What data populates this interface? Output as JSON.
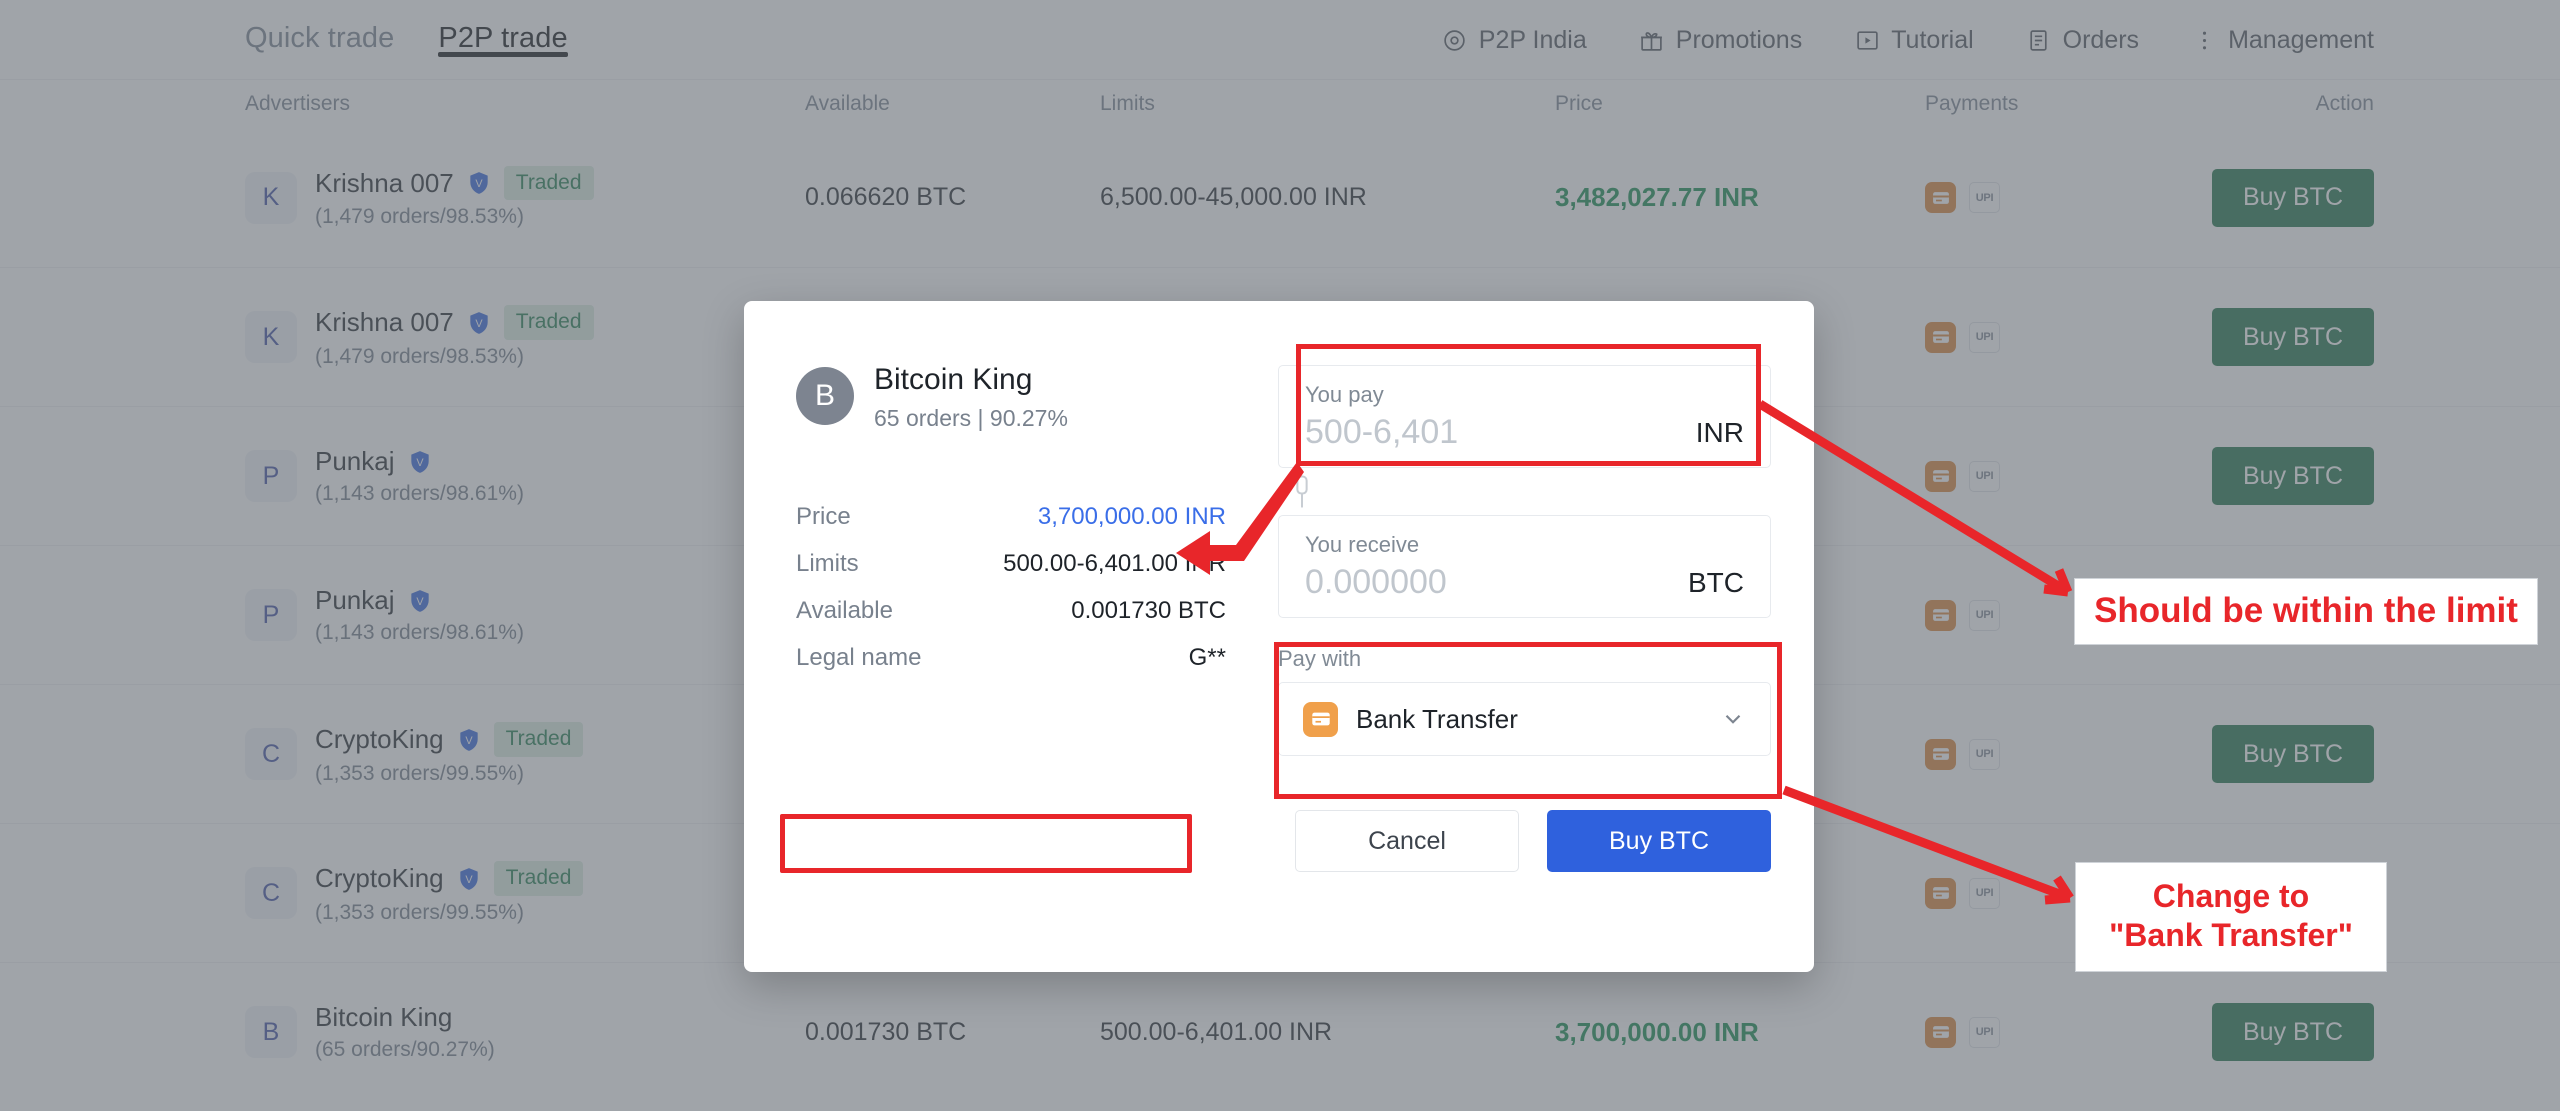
{
  "nav": {
    "tabs": [
      {
        "label": "Quick trade",
        "active": false
      },
      {
        "label": "P2P trade",
        "active": true
      }
    ],
    "links": [
      {
        "label": "P2P India",
        "icon": "globe-icon"
      },
      {
        "label": "Promotions",
        "icon": "gift-icon"
      },
      {
        "label": "Tutorial",
        "icon": "play-icon"
      },
      {
        "label": "Orders",
        "icon": "document-icon"
      },
      {
        "label": "Management",
        "icon": "kebab-menu-icon"
      }
    ]
  },
  "table": {
    "headers": {
      "advertisers": "Advertisers",
      "available": "Available",
      "limits": "Limits",
      "price": "Price",
      "payments": "Payments",
      "action": "Action"
    },
    "action_label": "Buy BTC",
    "traded_tag": "Traded",
    "payment_upi_label": "UPI",
    "rows": [
      {
        "initial": "K",
        "name": "Krishna 007",
        "verified": true,
        "traded": true,
        "stats": "(1,479 orders/98.53%)",
        "available": "0.066620 BTC",
        "limits": "6,500.00-45,000.00 INR",
        "price": "3,482,027.77 INR"
      },
      {
        "initial": "K",
        "name": "Krishna 007",
        "verified": true,
        "traded": true,
        "stats": "(1,479 orders/98.53%)",
        "available": "",
        "limits": "",
        "price": ""
      },
      {
        "initial": "P",
        "name": "Punkaj",
        "verified": true,
        "traded": false,
        "stats": "(1,143 orders/98.61%)",
        "available": "",
        "limits": "",
        "price": ""
      },
      {
        "initial": "P",
        "name": "Punkaj",
        "verified": true,
        "traded": false,
        "stats": "(1,143 orders/98.61%)",
        "available": "",
        "limits": "",
        "price": ""
      },
      {
        "initial": "C",
        "name": "CryptoKing",
        "verified": true,
        "traded": true,
        "stats": "(1,353 orders/99.55%)",
        "available": "",
        "limits": "",
        "price": ""
      },
      {
        "initial": "C",
        "name": "CryptoKing",
        "verified": true,
        "traded": true,
        "stats": "(1,353 orders/99.55%)",
        "available": "",
        "limits": "",
        "price": ""
      },
      {
        "initial": "B",
        "name": "Bitcoin King",
        "verified": false,
        "traded": false,
        "stats": "(65 orders/90.27%)",
        "available": "0.001730 BTC",
        "limits": "500.00-6,401.00 INR",
        "price": "3,700,000.00 INR"
      }
    ]
  },
  "modal": {
    "seller": {
      "initial": "B",
      "name": "Bitcoin King",
      "sub": "65 orders | 90.27%"
    },
    "details": [
      {
        "key": "Price",
        "value": "3,700,000.00 INR",
        "accent": "blue"
      },
      {
        "key": "Limits",
        "value": "500.00-6,401.00 INR",
        "accent": "none"
      },
      {
        "key": "Available",
        "value": "0.001730 BTC",
        "accent": "none"
      },
      {
        "key": "Legal name",
        "value": "G**",
        "accent": "none"
      }
    ],
    "you_pay": {
      "label": "You pay",
      "placeholder": "500-6,401",
      "value": "",
      "currency": "INR"
    },
    "you_receive": {
      "label": "You receive",
      "placeholder": "0.000000",
      "value": "",
      "currency": "BTC"
    },
    "pay_with": {
      "label": "Pay with",
      "selected": "Bank Transfer",
      "icon": "bank-card-icon"
    },
    "cancel_label": "Cancel",
    "confirm_label": "Buy BTC"
  },
  "annotations": [
    {
      "id": "limit",
      "text": "Should be within the limit"
    },
    {
      "id": "bank",
      "line1": "Change to",
      "line2": "\"Bank Transfer\""
    }
  ],
  "colors": {
    "accent_red": "#e8262a",
    "buy_green": "#1a6e44",
    "confirm_blue": "#2f61dd",
    "price_green": "#0f8a4a",
    "link_blue": "#3a6ee8"
  }
}
